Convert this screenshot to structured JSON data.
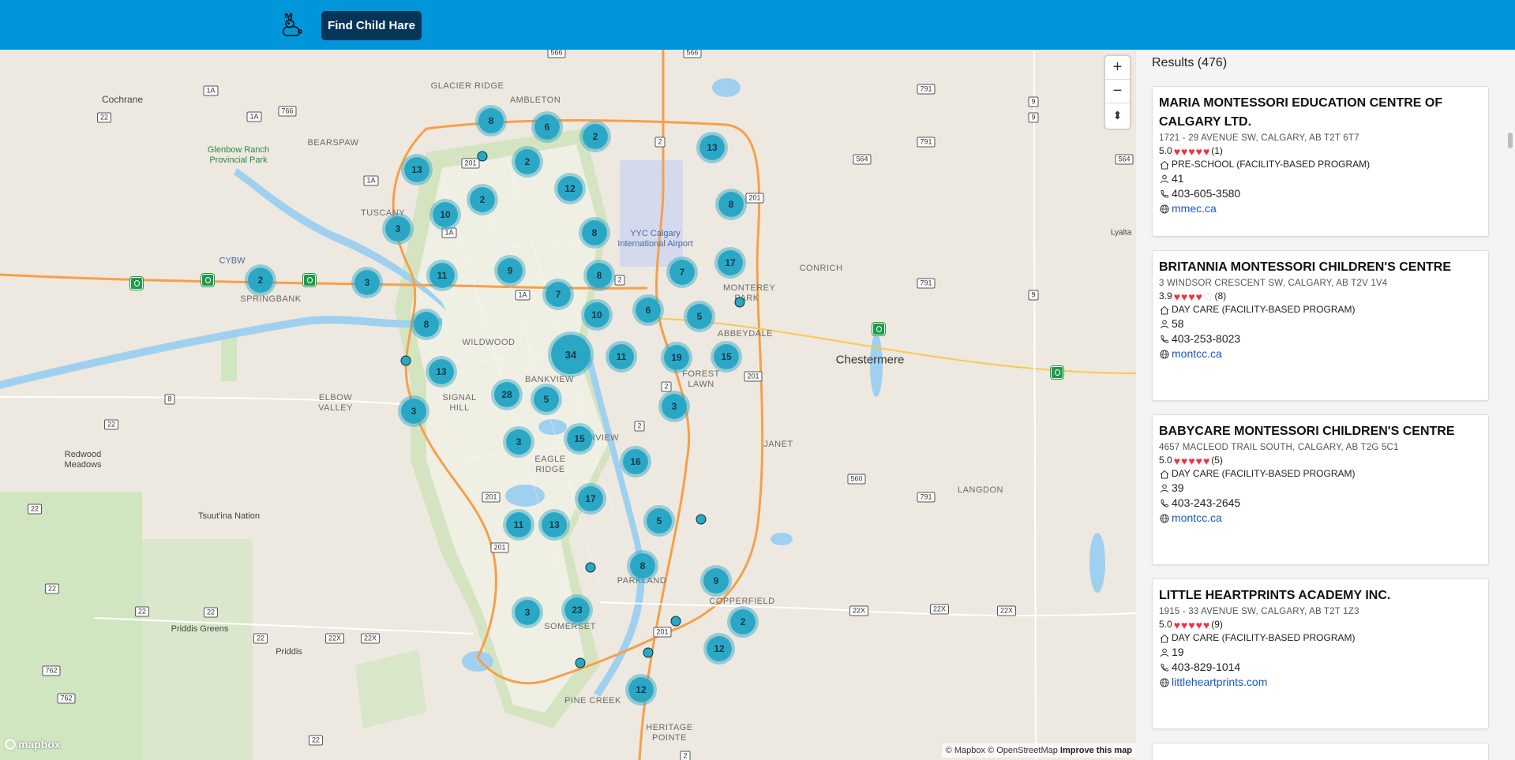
{
  "header": {
    "button_label": "Find Child Hare",
    "logo_icon": "rabbit-icon",
    "background": "#0195d9"
  },
  "map": {
    "zoom_in": "+",
    "zoom_out": "−",
    "compass": "⬍",
    "logo_text": "mapbox",
    "attribution_mapbox": "© Mapbox",
    "attribution_osm": "© OpenStreetMap",
    "improve": "Improve this map",
    "places": [
      "Cochrane",
      "GLACIER RIDGE",
      "AMBLETON",
      "BEARSPAW",
      "Glenbow Ranch Provincial Park",
      "TUSCANY",
      "CYBW",
      "SPRINGBANK",
      "YYC Calgary International Airport",
      "CONRICH",
      "MONTEREY PARK",
      "ABBEYDALE",
      "Chestermere",
      "WILDWOOD",
      "BANKVIEW",
      "FOREST LAWN",
      "SIGNAL HILL",
      "ELBOW VALLEY",
      "Redwood Meadows",
      "JANET",
      "EAGLE RIDGE",
      "FAIRVIEW",
      "Tsuut'ina Nation",
      "LANGDON",
      "PARKLAND",
      "COPPERFIELD",
      "Priddis Greens",
      "Priddis",
      "SOMERSET",
      "PINE CREEK",
      "HERITAGE POINTE",
      "Lyalta"
    ],
    "clusters": [
      "8",
      "6",
      "2",
      "2",
      "13",
      "12",
      "13",
      "2",
      "10",
      "3",
      "8",
      "8",
      "2",
      "3",
      "9",
      "8",
      "7",
      "17",
      "11",
      "8",
      "7",
      "10",
      "6",
      "5",
      "34",
      "11",
      "19",
      "15",
      "13",
      "28",
      "5",
      "3",
      "3",
      "15",
      "3",
      "16",
      "17",
      "11",
      "13",
      "5",
      "8",
      "9",
      "3",
      "23",
      "2",
      "12",
      "12"
    ]
  },
  "results": {
    "title": "Results (476)",
    "cards": [
      {
        "name": "MARIA MONTESSORI EDUCATION CENTRE OF CALGARY LTD.",
        "address": "1721 - 29 AVENUE SW, CALGARY, AB T2T 6T7",
        "rating": "5.0",
        "hearts_filled": 5,
        "reviews": "(1)",
        "type": "PRE-SCHOOL (FACILITY-BASED PROGRAM)",
        "capacity": "41",
        "phone": "403-605-3580",
        "website": "mmec.ca"
      },
      {
        "name": "BRITANNIA MONTESSORI CHILDREN'S CENTRE",
        "address": "3 WINDSOR CRESCENT SW, CALGARY, AB T2V 1V4",
        "rating": "3.9",
        "hearts_filled": 4,
        "reviews": "(8)",
        "type": "DAY CARE (FACILITY-BASED PROGRAM)",
        "capacity": "58",
        "phone": "403-253-8023",
        "website": "montcc.ca"
      },
      {
        "name": "BABYCARE MONTESSORI CHILDREN'S CENTRE",
        "address": "4657 MACLEOD TRAIL SOUTH, CALGARY, AB T2G 5C1",
        "rating": "5.0",
        "hearts_filled": 5,
        "reviews": "(5)",
        "type": "DAY CARE (FACILITY-BASED PROGRAM)",
        "capacity": "39",
        "phone": "403-243-2645",
        "website": "montcc.ca"
      },
      {
        "name": "LITTLE HEARTPRINTS ACADEMY INC.",
        "address": "1915 - 33 AVENUE SW, CALGARY, AB T2T 1Z3",
        "rating": "5.0",
        "hearts_filled": 5,
        "reviews": "(9)",
        "type": "DAY CARE (FACILITY-BASED PROGRAM)",
        "capacity": "19",
        "phone": "403-829-1014",
        "website": "littleheartprints.com"
      }
    ]
  }
}
